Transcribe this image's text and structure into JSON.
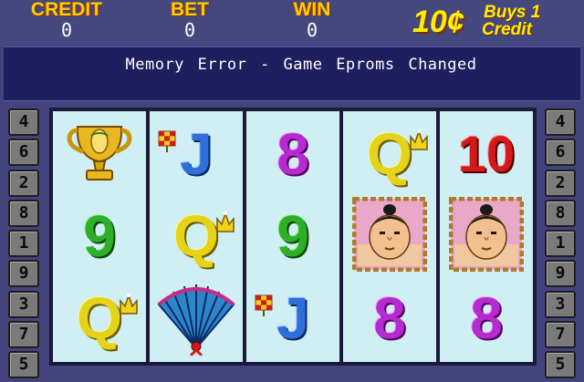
{
  "header": {
    "credit": {
      "label": "CREDIT",
      "value": "0"
    },
    "bet": {
      "label": "BET",
      "value": "0"
    },
    "win": {
      "label": "WIN",
      "value": "0"
    },
    "price": {
      "amount": "10¢",
      "line1": "Buys 1",
      "line2": "Credit"
    }
  },
  "message": "Memory Error - Game Eproms Changed",
  "paylines_left": [
    "4",
    "6",
    "2",
    "8",
    "1",
    "9",
    "3",
    "7",
    "5"
  ],
  "paylines_right": [
    "4",
    "6",
    "2",
    "8",
    "1",
    "9",
    "3",
    "7",
    "5"
  ],
  "reels": [
    {
      "symbols": [
        {
          "kind": "trophy",
          "label": "",
          "icon": "gold-trophy-icon"
        },
        {
          "kind": "card",
          "label": "9",
          "cls": "g9"
        },
        {
          "kind": "card",
          "label": "Q",
          "cls": "gQ",
          "crown": true
        }
      ]
    },
    {
      "symbols": [
        {
          "kind": "card",
          "label": "J",
          "cls": "gJ",
          "flag": true
        },
        {
          "kind": "card",
          "label": "Q",
          "cls": "gQ",
          "crown": true
        },
        {
          "kind": "fan",
          "label": "",
          "icon": "fan-icon"
        }
      ]
    },
    {
      "symbols": [
        {
          "kind": "card",
          "label": "8",
          "cls": "g8"
        },
        {
          "kind": "card",
          "label": "9",
          "cls": "g9"
        },
        {
          "kind": "card",
          "label": "J",
          "cls": "gJ",
          "flag": true
        }
      ]
    },
    {
      "symbols": [
        {
          "kind": "card",
          "label": "Q",
          "cls": "gQ",
          "crown": true
        },
        {
          "kind": "sumo",
          "label": "",
          "icon": "sumo-wrestler-icon"
        },
        {
          "kind": "card",
          "label": "8",
          "cls": "g8"
        }
      ]
    },
    {
      "symbols": [
        {
          "kind": "card",
          "label": "10",
          "cls": "g10"
        },
        {
          "kind": "sumo",
          "label": "",
          "icon": "sumo-wrestler-icon"
        },
        {
          "kind": "card",
          "label": "8",
          "cls": "g8"
        }
      ]
    }
  ],
  "colors": {
    "background": "#43447e",
    "reel_face": "#cfeff5",
    "label_gold": "#f5d000"
  }
}
